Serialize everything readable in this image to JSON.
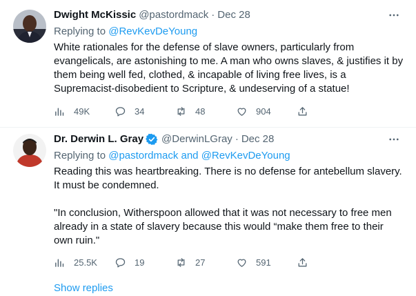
{
  "tweets": [
    {
      "author": {
        "name": "Dwight McKissic",
        "handle": "@pastordmack",
        "verified": false,
        "avatar": "avatar-photo"
      },
      "date": "Dec 28",
      "dot": "·",
      "reply_prefix": "Replying to ",
      "reply_mentions": [
        "@RevKevDeYoung"
      ],
      "reply_joiner": "",
      "body": [
        "White rationales for the defense of slave owners, particularly from evangelicals, are astonishing to me. A man who owns slaves, & justifies it by them being well fed, clothed, & incapable of living free lives, is a Supremacist-disobedient to Scripture, & undeserving of a statue!"
      ],
      "stats": {
        "views": "49K",
        "replies": "34",
        "retweets": "48",
        "likes": "904"
      }
    },
    {
      "author": {
        "name": "Dr. Derwin L. Gray",
        "handle": "@DerwinLGray",
        "verified": true,
        "avatar": "avatar-photo"
      },
      "date": "Dec 28",
      "dot": "·",
      "reply_prefix": "Replying to ",
      "reply_mentions": [
        "@pastordmack",
        "@RevKevDeYoung"
      ],
      "reply_joiner": " and ",
      "body": [
        "Reading this was heartbreaking. There is no defense for antebellum slavery. It must be condemned.",
        "\"In conclusion, Witherspoon allowed that it was not necessary to free men already in a state of slavery because this would “make them free to their own ruin.\""
      ],
      "stats": {
        "views": "25.5K",
        "replies": "19",
        "retweets": "27",
        "likes": "591"
      }
    }
  ],
  "show_replies": "Show replies",
  "icons": {
    "views": "bar-chart-icon",
    "replies": "comment-icon",
    "retweets": "retweet-icon",
    "likes": "heart-icon",
    "share": "share-icon",
    "more": "more-horizontal-icon",
    "verified": "verified-badge-icon"
  },
  "colors": {
    "accent": "#1d9bf0",
    "secondary_text": "#536471",
    "primary_text": "#0f1419",
    "divider": "#eff3f4"
  }
}
